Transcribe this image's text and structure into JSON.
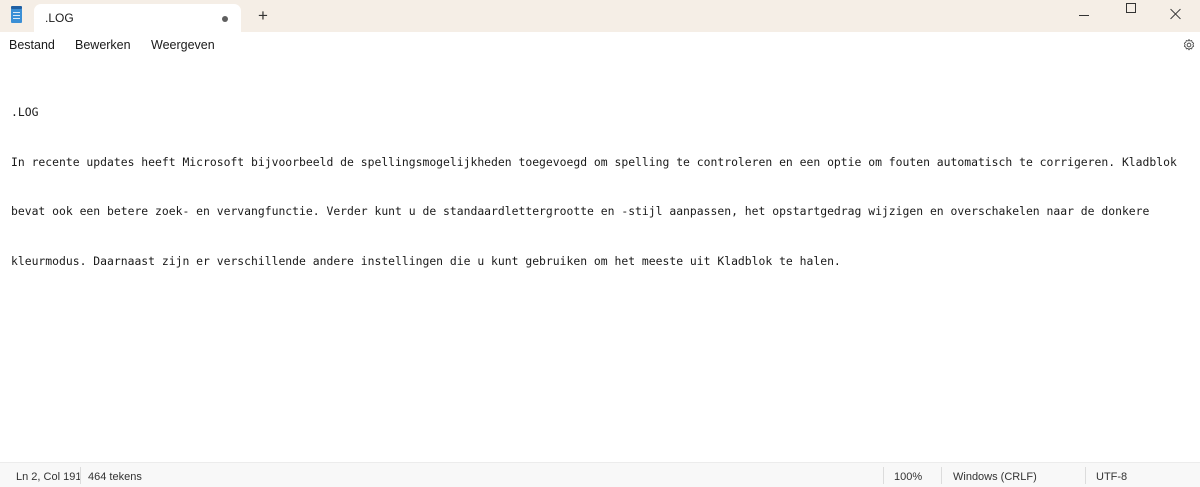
{
  "tab": {
    "title": ".LOG",
    "new_tab_symbol": "+"
  },
  "window_controls": {
    "minimize_icon": "minimize-icon",
    "maximize_icon": "maximize-icon",
    "close_icon": "close-icon"
  },
  "menu": {
    "items": [
      "Bestand",
      "Bewerken",
      "Weergeven"
    ],
    "settings_icon": "gear-icon"
  },
  "document": {
    "lines": [
      ".LOG",
      "In recente updates heeft Microsoft bijvoorbeeld de spellingsmogelijkheden toegevoegd om spelling te controleren en een optie om fouten automatisch te corrigeren. Kladblok",
      "bevat ook een betere zoek- en vervangfunctie. Verder kunt u de standaardlettergrootte en -stijl aanpassen, het opstartgedrag wijzigen en overschakelen naar de donkere",
      "kleurmodus. Daarnaast zijn er verschillende andere instellingen die u kunt gebruiken om het meeste uit Kladblok te halen."
    ]
  },
  "status": {
    "position": "Ln 2, Col 191",
    "char_count": "464 tekens",
    "zoom": "100%",
    "line_ending": "Windows (CRLF)",
    "encoding": "UTF-8"
  },
  "colors": {
    "titlebar_bg": "#f5eee6",
    "app_icon_accent": "#3a8fd6"
  }
}
